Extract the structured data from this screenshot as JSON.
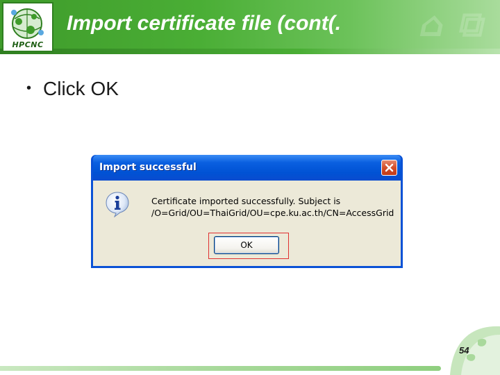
{
  "slide": {
    "title": "Import certificate file (cont(.",
    "logo_text": "HPCNC",
    "bullet": "Click OK",
    "page_number": "54"
  },
  "dialog": {
    "title": "Import successful",
    "message_line1": "Certificate imported successfully. Subject is",
    "message_line2": "/O=Grid/OU=ThaiGrid/OU=cpe.ku.ac.th/CN=AccessGrid",
    "ok_label": "OK",
    "icon": "info-icon",
    "close_icon": "close-icon"
  },
  "colors": {
    "header_green": "#4aae35",
    "titlebar_blue": "#0052d4",
    "dialog_bg": "#ece9d8",
    "highlight_red": "#e03030"
  }
}
